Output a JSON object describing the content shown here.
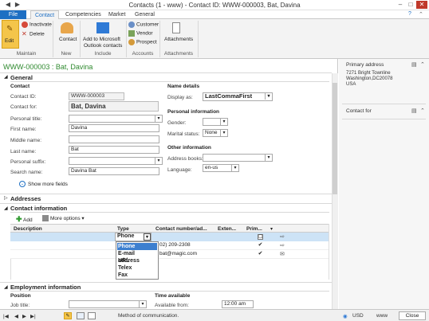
{
  "window": {
    "title": "Contacts (1 - www) - Contact ID: WWW-000003, Bat, Davina"
  },
  "ribbon": {
    "tabs": [
      "File",
      "Contact",
      "Competencies",
      "Market",
      "General"
    ],
    "maintain": {
      "edit": "Edit",
      "inactivate": "Inactivate",
      "delete": "Delete",
      "group": "Maintain"
    },
    "new": {
      "contact": "Contact",
      "group": "New"
    },
    "include": {
      "add": "Add to Microsoft Outlook contacts",
      "add_line1": "Add to Microsoft",
      "add_line2": "Outlook contacts",
      "group": "Include"
    },
    "accounts": {
      "customer": "Customer",
      "vendor": "Vendor",
      "prospect": "Prospect",
      "group": "Accounts"
    },
    "attachments": {
      "label": "Attachments",
      "group": "Attachments"
    }
  },
  "record_title": "WWW-000003 : Bat, Davina",
  "general": {
    "header": "General",
    "contact_header": "Contact",
    "contact_id_label": "Contact ID:",
    "contact_id": "WWW-000003",
    "contact_for_label": "Contact for:",
    "contact_for": "Bat, Davina",
    "personal_title_label": "Personal title:",
    "first_name_label": "First name:",
    "first_name": "Davina",
    "middle_name_label": "Middle name:",
    "last_name_label": "Last name:",
    "last_name": "Bat",
    "personal_suffix_label": "Personal suffix:",
    "search_name_label": "Search name:",
    "search_name": "Davina Bat",
    "show_more": "Show more fields",
    "name_details_header": "Name details",
    "display_as_label": "Display as:",
    "display_as": "LastCommaFirst",
    "personal_info_header": "Personal information",
    "gender_label": "Gender:",
    "marital_label": "Marital status:",
    "marital": "None",
    "other_info_header": "Other information",
    "address_books_label": "Address books:",
    "language_label": "Language:",
    "language": "en-us"
  },
  "addresses": {
    "header": "Addresses"
  },
  "contact_info": {
    "header": "Contact information",
    "add": "Add",
    "more_options": "More options",
    "columns": [
      "Description",
      "Type",
      "Contact number/ad...",
      "Exten...",
      "Prim..."
    ],
    "rows": [
      {
        "description": "",
        "type": "Phone",
        "number": "",
        "primary": "☐"
      },
      {
        "description": "",
        "type": "",
        "number": "02) 209-2308",
        "primary": "✔"
      },
      {
        "description": "",
        "type": "",
        "number": "bat@magic.com",
        "primary": "✔"
      }
    ],
    "type_options": [
      "Phone",
      "E-mail address",
      "URL",
      "Telex",
      "Fax"
    ]
  },
  "employment": {
    "header": "Employment information",
    "position_header": "Position",
    "job_title_label": "Job title:",
    "time_header": "Time available",
    "available_from_label": "Available from:",
    "available_from": "12:00 am"
  },
  "right_panel": {
    "primary_address_title": "Primary address",
    "address_line1": "7271 Bright Townline",
    "address_line2": "Washington,DC20078",
    "address_line3": "USA",
    "contact_for_title": "Contact for"
  },
  "status": {
    "help_text": "Method of communication.",
    "currency": "USD",
    "company": "www",
    "close": "Close"
  },
  "colors": {
    "accent": "#1e6fc3",
    "record_title": "#2f8a2f",
    "edit_button": "#f4c54a",
    "selected_row": "#cde3f6"
  }
}
